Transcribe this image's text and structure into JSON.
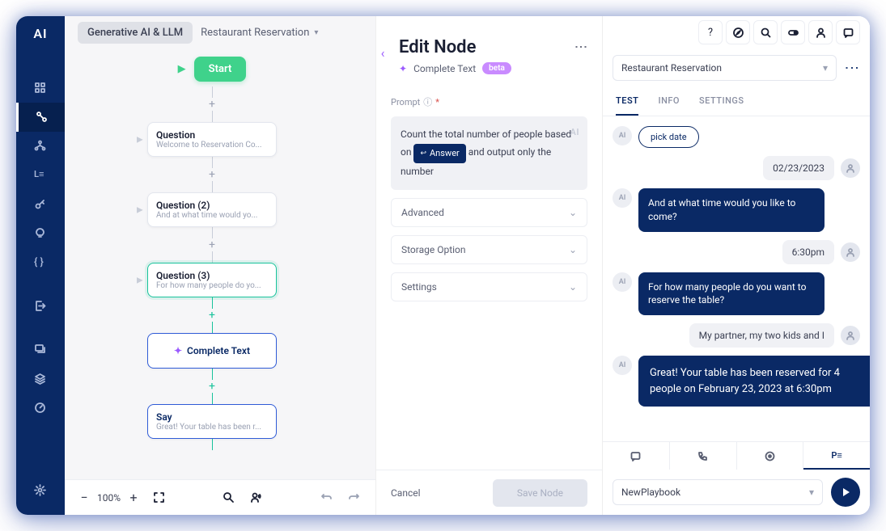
{
  "logo": "AI",
  "header": {
    "category": "Generative AI & LLM",
    "breadcrumb": "Restaurant Reservation"
  },
  "flow": {
    "start": "Start",
    "nodes": [
      {
        "title": "Question",
        "sub": "Welcome to Reservation Co..."
      },
      {
        "title": "Question (2)",
        "sub": "And at what time would yo..."
      },
      {
        "title": "Question (3)",
        "sub": "For how many people do yo..."
      },
      {
        "title": "Complete Text",
        "sub": ""
      },
      {
        "title": "Say",
        "sub": "Great! Your table has been r..."
      }
    ]
  },
  "canvas_footer": {
    "zoom": "100%"
  },
  "edit": {
    "title": "Edit Node",
    "node_type": "Complete Text",
    "badge": "beta",
    "prompt_label": "Prompt",
    "prompt_required": "*",
    "prompt_pre": "Count the total number of people based on ",
    "prompt_token": "Answer",
    "prompt_post": " and output only the number",
    "ai_mark": "AI",
    "sections": [
      "Advanced",
      "Storage Option",
      "Settings"
    ],
    "cancel": "Cancel",
    "save": "Save Node"
  },
  "chat": {
    "select": "Restaurant Reservation",
    "tabs": [
      "TEST",
      "INFO",
      "SETTINGS"
    ],
    "pill": "pick date",
    "messages": {
      "u_date": "02/23/2023",
      "ai_time": "And at what time would you like to come?",
      "u_time": "6:30pm",
      "ai_people": "For how many people do you want to reserve the table?",
      "u_people": "My partner, my two kids and I",
      "ai_final": "Great! Your table has been reserved for 4 people on February 23, 2023 at 6:30pm"
    },
    "playbook": "NewPlaybook"
  }
}
